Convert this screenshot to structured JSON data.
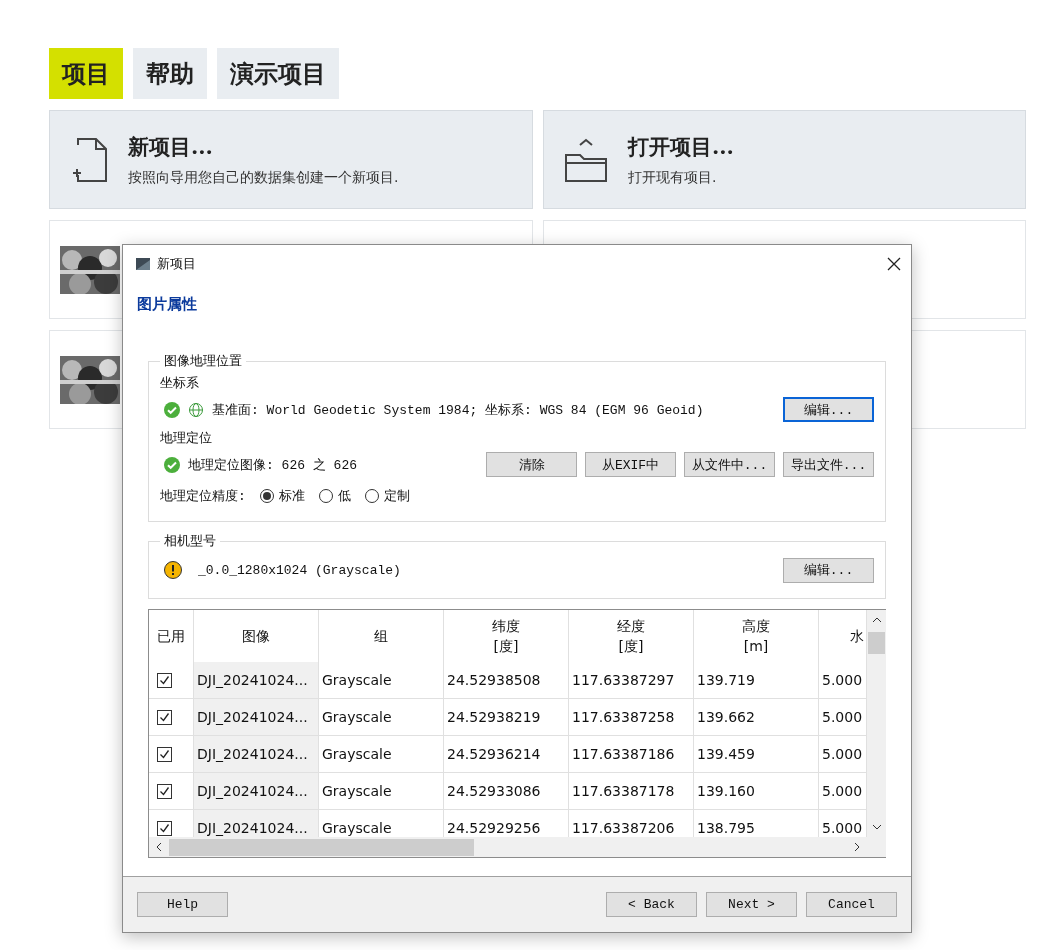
{
  "menu_tabs": [
    {
      "label": "项目",
      "selected": true
    },
    {
      "label": "帮助",
      "selected": false
    },
    {
      "label": "演示项目",
      "selected": false
    }
  ],
  "actions": [
    {
      "kind": "new",
      "title": "新项目...",
      "description": "按照向导用您自己的数据集创建一个新项目."
    },
    {
      "kind": "open",
      "title": "打开项目...",
      "description": "打开现有项目."
    }
  ],
  "recent_projects": [
    {
      "kind": "picture"
    },
    {
      "kind": "empty"
    },
    {
      "kind": "picture"
    },
    {
      "kind": "empty"
    }
  ],
  "dialog": {
    "title": "新项目",
    "heading": "图片属性",
    "geolocation": {
      "legend": "图像地理位置",
      "crs_label": "坐标系",
      "crs_status": {
        "kind": "ok"
      },
      "crs_text": "基准面: World Geodetic System 1984; 坐标系: WGS 84 (EGM 96 Geoid)",
      "crs_button": {
        "label": "编辑...",
        "focused": true
      },
      "geo_label": "地理定位",
      "geo_status": {
        "kind": "ok"
      },
      "geo_text": "地理定位图像: 626 之 626",
      "geo_buttons": [
        "清除",
        "从EXIF中",
        "从文件中...",
        "导出文件..."
      ],
      "accuracy_label": "地理定位精度:",
      "accuracy_options": [
        {
          "label": "标准",
          "selected": true
        },
        {
          "label": "低",
          "selected": false
        },
        {
          "label": "定制",
          "selected": false
        }
      ]
    },
    "camera": {
      "legend": "相机型号",
      "status": {
        "kind": "warning"
      },
      "text": "_0.0_1280x1024 (Grayscale)",
      "button": {
        "label": "编辑...",
        "focused": false
      }
    },
    "table": {
      "columns": [
        {
          "lines": [
            "已用"
          ]
        },
        {
          "lines": [
            "图像"
          ]
        },
        {
          "lines": [
            "组"
          ]
        },
        {
          "lines": [
            "纬度",
            "[度]"
          ]
        },
        {
          "lines": [
            "经度",
            "[度]"
          ]
        },
        {
          "lines": [
            "高度",
            "[m]"
          ]
        },
        {
          "lines": [
            "水"
          ]
        }
      ],
      "rows": [
        {
          "enabled": true,
          "image": "DJI_20241024...",
          "group": "Grayscale",
          "latitude": "24.52938508",
          "longitude": "117.63387297",
          "altitude": "139.719",
          "column_7": "5.000"
        },
        {
          "enabled": true,
          "image": "DJI_20241024...",
          "group": "Grayscale",
          "latitude": "24.52938219",
          "longitude": "117.63387258",
          "altitude": "139.662",
          "column_7": "5.000"
        },
        {
          "enabled": true,
          "image": "DJI_20241024...",
          "group": "Grayscale",
          "latitude": "24.52936214",
          "longitude": "117.63387186",
          "altitude": "139.459",
          "column_7": "5.000"
        },
        {
          "enabled": true,
          "image": "DJI_20241024...",
          "group": "Grayscale",
          "latitude": "24.52933086",
          "longitude": "117.63387178",
          "altitude": "139.160",
          "column_7": "5.000"
        },
        {
          "enabled": true,
          "image": "DJI_20241024...",
          "group": "Grayscale",
          "latitude": "24.52929256",
          "longitude": "117.63387206",
          "altitude": "138.795",
          "column_7": "5.000"
        }
      ]
    },
    "footer_left": [
      "Help"
    ],
    "footer_right": [
      "< Back",
      "Next >",
      "Cancel"
    ]
  }
}
